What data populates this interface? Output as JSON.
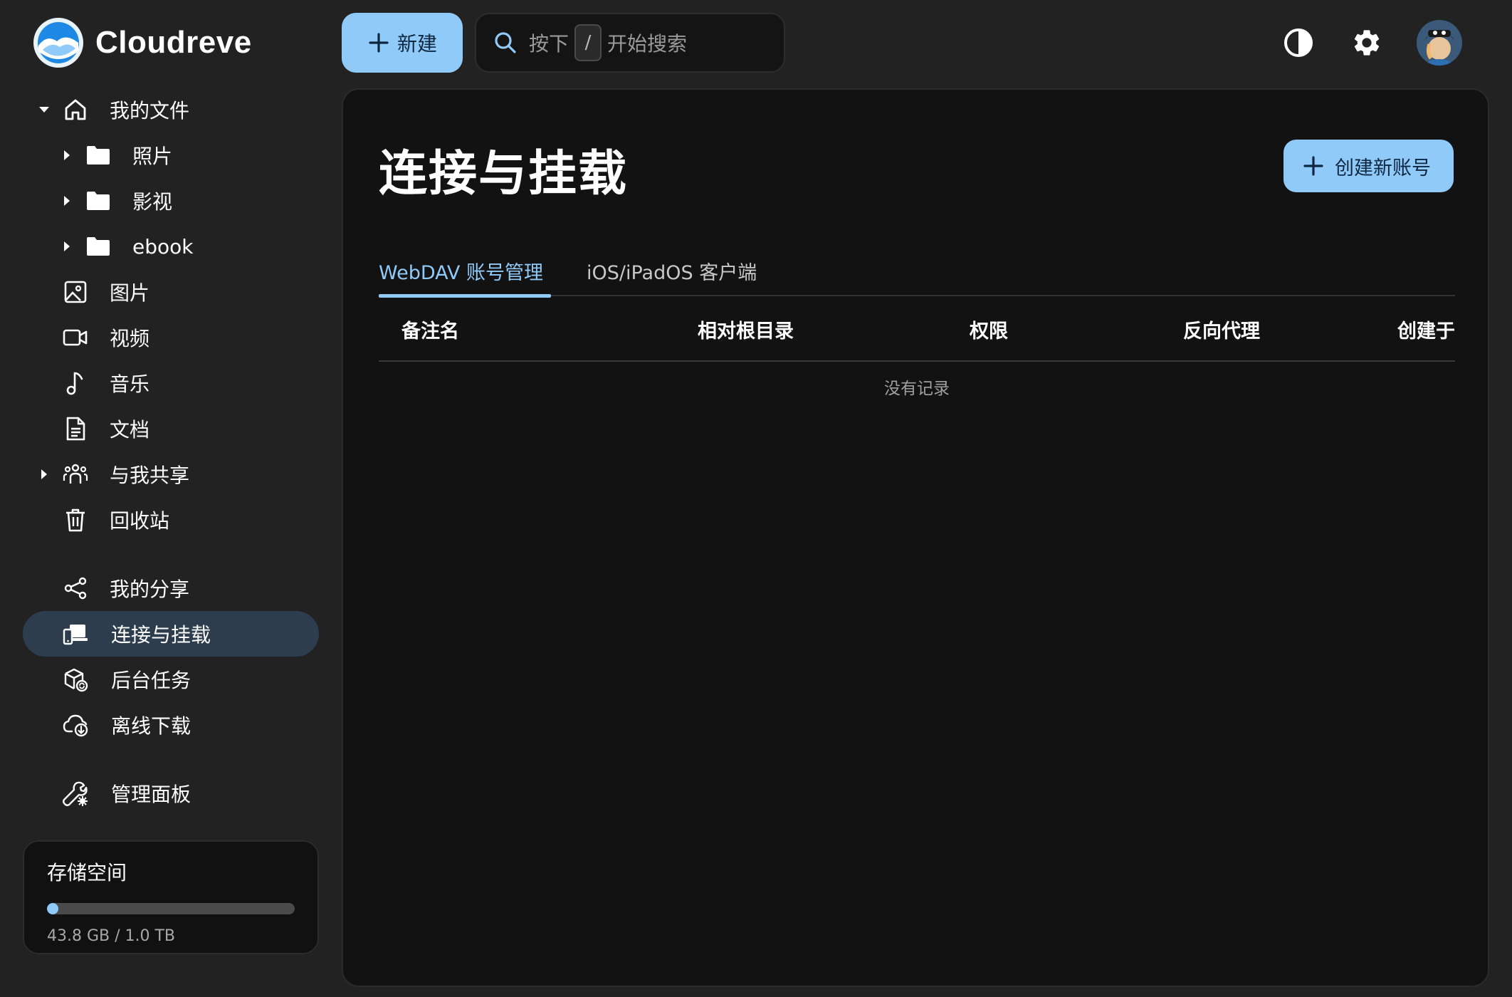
{
  "app": {
    "name": "Cloudreve"
  },
  "header": {
    "new_label": "新建",
    "search_prefix": "按下",
    "search_key": "/",
    "search_suffix": "开始搜索",
    "icons": [
      "theme-contrast-icon",
      "gear-icon"
    ]
  },
  "sidebar": {
    "my_files": "我的文件",
    "folders": [
      "照片",
      "影视",
      "ebook"
    ],
    "categories": [
      "图片",
      "视频",
      "音乐",
      "文档"
    ],
    "shared_with_me": "与我共享",
    "trash": "回收站",
    "my_shares": "我的分享",
    "connect_mount": "连接与挂载",
    "background_tasks": "后台任务",
    "offline_download": "离线下载",
    "admin_panel": "管理面板"
  },
  "storage": {
    "title": "存储空间",
    "used_text": "43.8 GB / 1.0 TB",
    "used_fraction": 0.043
  },
  "main": {
    "title": "连接与挂载",
    "create_button": "创建新账号",
    "tabs": [
      {
        "label": "WebDAV 账号管理",
        "active": true
      },
      {
        "label": "iOS/iPadOS 客户端",
        "active": false
      }
    ],
    "columns": [
      "备注名",
      "相对根目录",
      "权限",
      "反向代理",
      "创建于"
    ],
    "empty_text": "没有记录"
  },
  "colors": {
    "accent": "#90caf9",
    "background": "#222222",
    "panel": "#121212",
    "active_nav": "#2d3d4e"
  }
}
